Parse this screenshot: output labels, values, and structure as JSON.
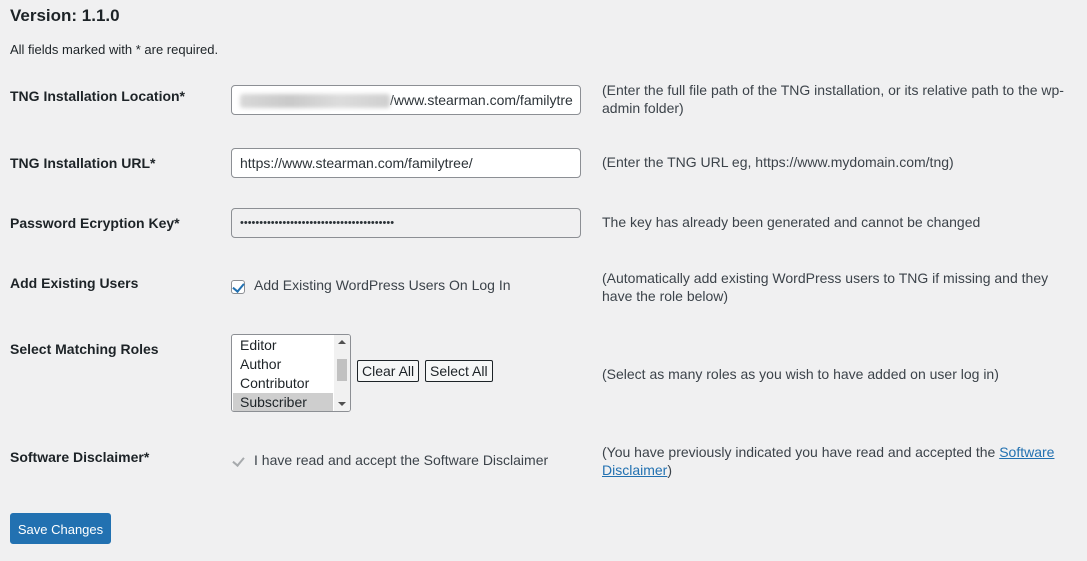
{
  "header": {
    "version_label": "Version: 1.1.0",
    "required_note": "All fields marked with * are required."
  },
  "fields": {
    "location": {
      "label": "TNG Installation Location*",
      "value_visible": "/www.stearman.com/familytre",
      "description": "(Enter the full file path of the TNG installation, or its relative path to the wp-admin folder)"
    },
    "url": {
      "label": "TNG Installation URL*",
      "value": "https://www.stearman.com/familytree/",
      "description": "(Enter the TNG URL eg, https://www.mydomain.com/tng)"
    },
    "key": {
      "label": "Password Ecryption Key*",
      "value": "••••••••••••••••••••••••••••••••••••••••",
      "description": "The key has already been generated and cannot be changed"
    },
    "existing_users": {
      "label": "Add Existing Users",
      "checkbox_label": "Add Existing WordPress Users On Log In",
      "checked": true,
      "description": "(Automatically add existing WordPress users to TNG if missing and they have the role below)"
    },
    "roles": {
      "label": "Select Matching Roles",
      "options": [
        "Editor",
        "Author",
        "Contributor",
        "Subscriber"
      ],
      "selected": "Subscriber",
      "clear_all_label": "Clear All",
      "select_all_label": "Select All",
      "description": "(Select as many roles as you wish to have added on user log in)"
    },
    "disclaimer": {
      "label": "Software Disclaimer*",
      "checkbox_label": "I have read and accept the Software Disclaimer",
      "checked": true,
      "description_before": "(You have previously indicated you have read and accepted the ",
      "link_text": "Software Disclaimer",
      "description_after": ")"
    }
  },
  "actions": {
    "save_label": "Save Changes"
  },
  "colors": {
    "accent": "#2271b1",
    "background": "#f0f0f1"
  }
}
